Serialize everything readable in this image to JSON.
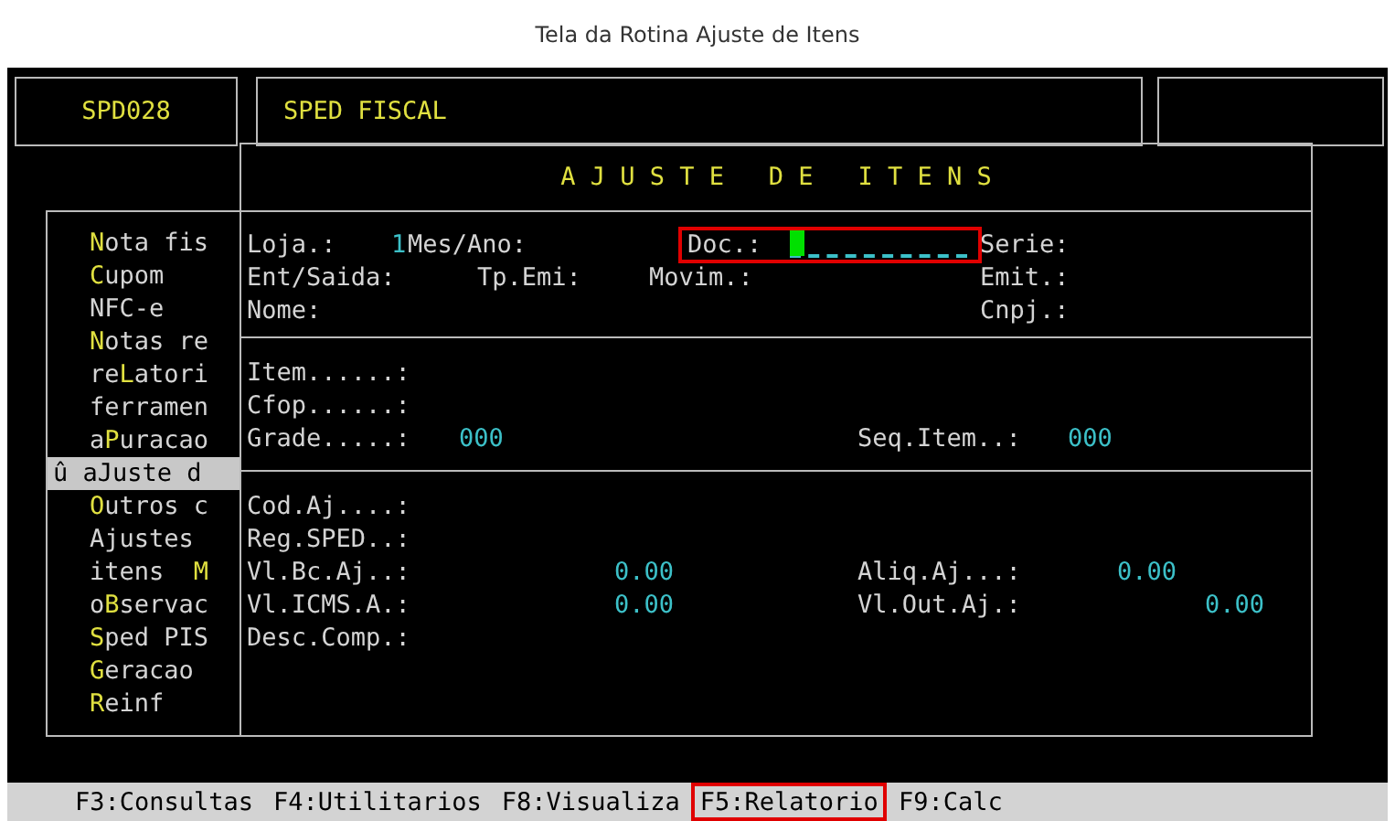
{
  "caption": "Tela da Rotina Ajuste de Itens",
  "header": {
    "program_code": "SPD028",
    "system_title": "SPED FISCAL"
  },
  "menu": [
    {
      "key": "N",
      "after": "ota fis",
      "selected": false
    },
    {
      "key": "C",
      "after": "upom",
      "selected": false
    },
    {
      "before": "NFC-e",
      "selected": false
    },
    {
      "key": "N",
      "after": "otas re",
      "selected": false
    },
    {
      "before": "re",
      "key": "L",
      "after": "atori",
      "selected": false
    },
    {
      "before": "ferramen",
      "selected": false
    },
    {
      "before": "a",
      "key": "P",
      "after": "uracao",
      "selected": false
    },
    {
      "before": "û a",
      "key": "J",
      "after": "uste d",
      "selected": true
    },
    {
      "key": "O",
      "after": "utros c",
      "selected": false
    },
    {
      "before": "Ajustes",
      "selected": false
    },
    {
      "before": "itens  ",
      "key": "M",
      "selected": false
    },
    {
      "before": "o",
      "key": "B",
      "after": "servac",
      "selected": false
    },
    {
      "key": "S",
      "after": "ped PIS",
      "selected": false
    },
    {
      "key": "G",
      "after": "eracao",
      "selected": false
    },
    {
      "key": "R",
      "after": "einf",
      "selected": false
    }
  ],
  "panel": {
    "title": "A J U S T E   D E   I T E N S",
    "sections": [
      [
        [
          {
            "label": "Loja.:",
            "value": "1"
          },
          {
            "label": "Mes/Ano:"
          },
          {
            "label": "Doc.:",
            "kind": "input",
            "cursor": true,
            "highlighted": true
          },
          {
            "label": "Serie:"
          }
        ],
        [
          {
            "label": "Ent/Saida:"
          },
          {
            "label": "Tp.Emi:"
          },
          {
            "label": "Movim.:"
          },
          {
            "label": "Emit.:"
          }
        ],
        [
          {
            "label": "Nome:"
          },
          {
            "label": "Cnpj.:"
          }
        ]
      ],
      [
        [
          {
            "label": "Item......:"
          }
        ],
        [
          {
            "label": "Cfop......:"
          }
        ],
        [
          {
            "label": "Grade.....:",
            "value": "000"
          },
          {
            "label": "Seq.Item..:",
            "value": "000"
          }
        ]
      ],
      [
        [
          {
            "label": "Cod.Aj....:"
          }
        ],
        [
          {
            "label": "Reg.SPED..:"
          }
        ],
        [
          {
            "label": "Vl.Bc.Aj..:",
            "value": "0.00"
          },
          {
            "label": "Aliq.Aj...:",
            "value": "0.00"
          }
        ],
        [
          {
            "label": "Vl.ICMS.A.:",
            "value": "0.00"
          },
          {
            "label": "Vl.Out.Aj.:",
            "value": "0.00"
          }
        ],
        [
          {
            "label": "Desc.Comp.:"
          }
        ]
      ]
    ]
  },
  "status_bar": [
    {
      "text": "F3:Consultas",
      "highlighted": false
    },
    {
      "text": "F4:Utilitarios",
      "highlighted": false
    },
    {
      "text": "F8:Visualiza",
      "highlighted": false
    },
    {
      "text": "F5:Relatorio",
      "highlighted": true
    },
    {
      "text": "F9:Calc",
      "highlighted": false
    }
  ]
}
